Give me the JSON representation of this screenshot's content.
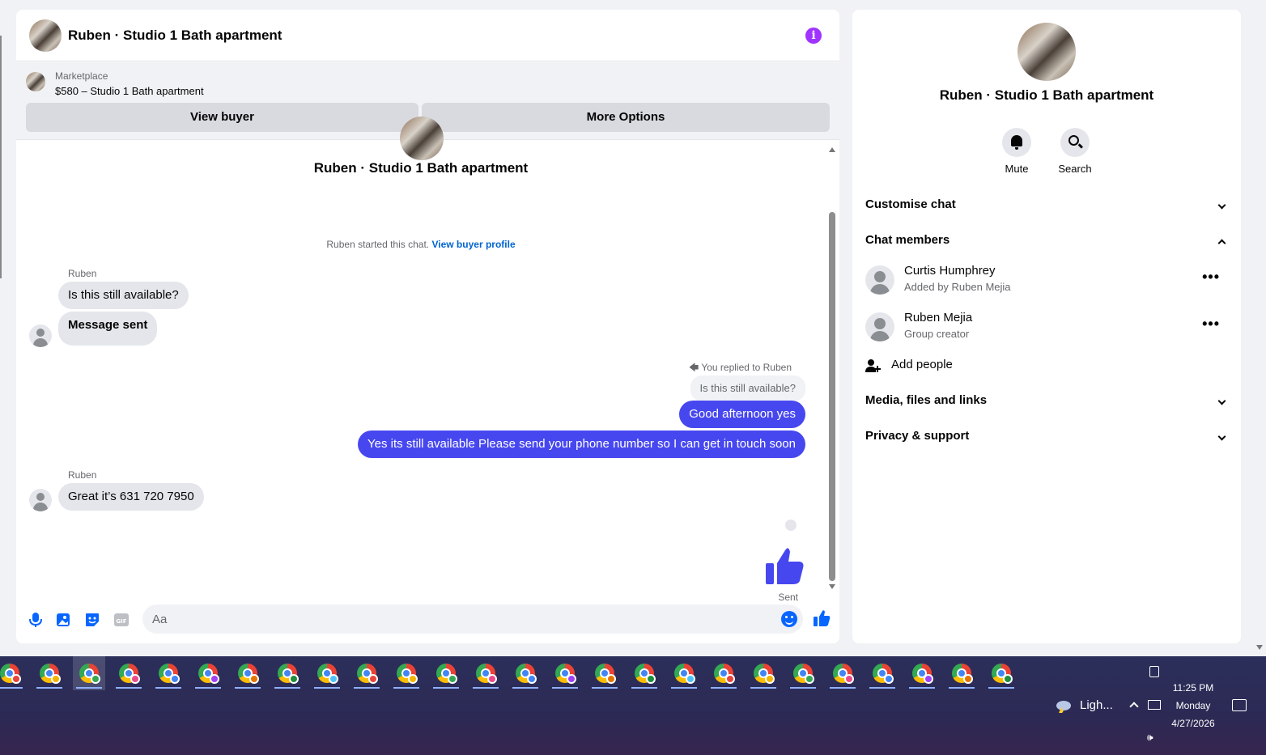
{
  "chat": {
    "title": "Ruben · Studio 1 Bath apartment",
    "marketplace_label": "Marketplace",
    "listing": "$580 – Studio 1 Bath apartment",
    "view_buyer_label": "View buyer",
    "more_options_label": "More Options",
    "thread_title": "Ruben · Studio 1 Bath apartment",
    "started_text": "Ruben started this chat.",
    "started_link": "View buyer profile"
  },
  "messages": [
    {
      "sender": "Ruben",
      "text": "Is this still available?"
    },
    {
      "text": "Message sent"
    },
    {
      "reply_note": "You replied to Ruben",
      "quoted": "Is this still available?"
    },
    {
      "text": "Good afternoon yes"
    },
    {
      "text": "Yes its still available Please send your phone number so I can get in touch soon"
    },
    {
      "sender": "Ruben",
      "text": "Great it’s 631 720 7950"
    },
    {
      "status": "Sent"
    }
  ],
  "composer": {
    "placeholder": "Aa"
  },
  "info": {
    "title": "Ruben · Studio 1 Bath apartment",
    "mute_label": "Mute",
    "search_label": "Search",
    "sections": {
      "customise": "Customise chat",
      "members": "Chat members",
      "media": "Media, files and links",
      "privacy": "Privacy & support"
    },
    "members": [
      {
        "name": "Curtis Humphrey",
        "sub": "Added by Ruben Mejia"
      },
      {
        "name": "Ruben Mejia",
        "sub": "Group creator"
      }
    ],
    "more_glyph": "•••",
    "add_people": "Add people"
  },
  "taskbar": {
    "app_count": 26,
    "weather": "Ligh...",
    "time": "11:25 PM",
    "day": "Monday",
    "date": "4/27/2026"
  },
  "colors": {
    "accent": "#4747f0",
    "link": "#0064d1",
    "info_icon": "#a033ff",
    "icon_blue": "#0866ff"
  }
}
